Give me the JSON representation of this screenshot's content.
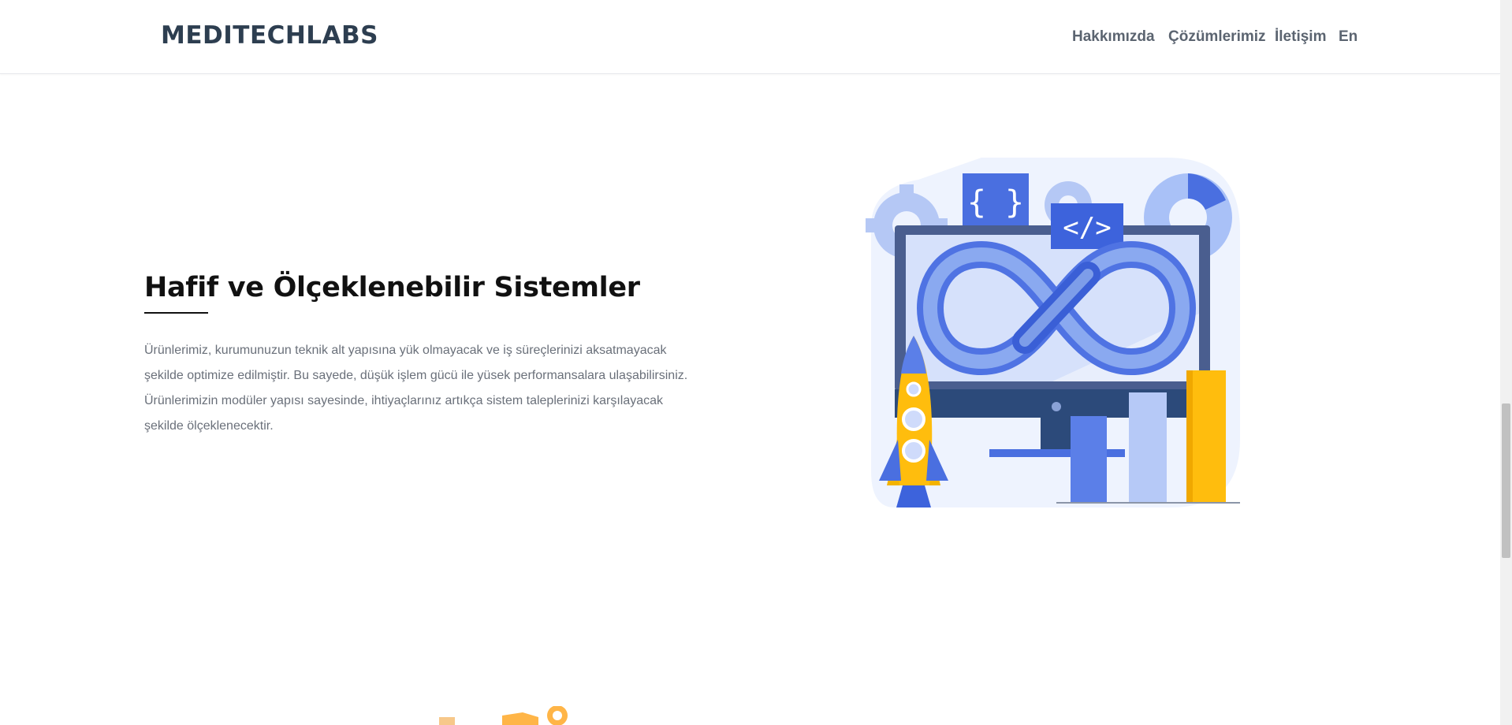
{
  "header": {
    "logo_text": "MEDITECHLABS",
    "nav": [
      {
        "label": "Hakkımızda"
      },
      {
        "label": "Çözümlerimiz"
      },
      {
        "label": "İletişim"
      },
      {
        "label": "En"
      }
    ]
  },
  "main": {
    "title": "Hafif ve Ölçeklenebilir Sistemler",
    "paragraph_lines": [
      "Ürünlerimiz, kurumunuzun teknik alt yapısına yük olmayacak ve iş süreçlerinizi aksatmayacak",
      "şekilde optimize edilmiştir. Bu sayede, düşük işlem gücü ile yüsek performansalara ulaşabilirsiniz.",
      "Ürünlerimizin modüler yapısı sayesinde, ihtiyaçlarınız artıkça sistem taleplerinizi karşılayacak",
      "şekilde ölçeklenecektir."
    ],
    "illustration_icon": "devops-infinity-monitor-rocket-illustration"
  },
  "colors": {
    "primary_blue": "#4c6ee0",
    "light_blue": "#c8d6fb",
    "navy": "#2c4a7a",
    "accent_yellow": "#ffbd0d",
    "logo": "#2d3e50"
  }
}
